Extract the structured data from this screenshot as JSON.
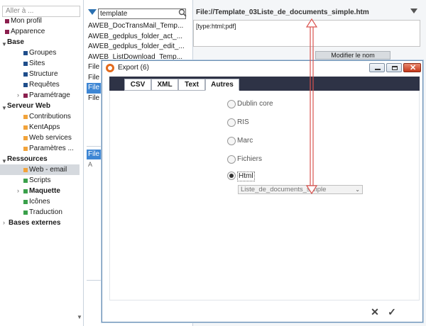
{
  "nav": {
    "search_placeholder": "Aller à ...",
    "items": [
      {
        "label": "Mon profil",
        "color": "#8b1f4e"
      },
      {
        "label": "Apparence",
        "color": "#8b1f4e"
      },
      {
        "label": "Base"
      },
      {
        "label": "Groupes",
        "color": "#1f4e8b"
      },
      {
        "label": "Sites",
        "color": "#1f4e8b"
      },
      {
        "label": "Structure",
        "color": "#1f4e8b"
      },
      {
        "label": "Requêtes",
        "color": "#1f4e8b"
      },
      {
        "label": "Paramétrage",
        "color": "#8b1f4e"
      },
      {
        "label": "Serveur Web"
      },
      {
        "label": "Contributions",
        "color": "#f2a33a"
      },
      {
        "label": "KentApps",
        "color": "#f2a33a"
      },
      {
        "label": "Web services",
        "color": "#f2a33a"
      },
      {
        "label": "Paramètres ...",
        "color": "#f2a33a"
      },
      {
        "label": "Ressources"
      },
      {
        "label": "Web - email",
        "color": "#f2a33a"
      },
      {
        "label": "Scripts",
        "color": "#3aa04a"
      },
      {
        "label": "Maquette",
        "color": "#3aa04a"
      },
      {
        "label": "Icônes",
        "color": "#3aa04a"
      },
      {
        "label": "Traduction",
        "color": "#3aa04a"
      },
      {
        "label": "Bases externes"
      }
    ]
  },
  "list": {
    "search_value": "template",
    "items": [
      "AWEB_DocTransMail_Temp...",
      "AWEB_gedplus_folder_act_...",
      "AWEB_gedplus_folder_edit_...",
      "AWEB_ListDownload_Temp...",
      "File",
      "File",
      "File",
      "File"
    ],
    "lower_selected": "File",
    "lower_marker": "A"
  },
  "detail": {
    "title": "File://Template_03Liste_de_documents_simple.htm",
    "types": "[type:html;pdf]",
    "modify_label": "Modifier le nom"
  },
  "dialog": {
    "title": "Export (6)",
    "tabs": [
      "CSV",
      "XML",
      "Text",
      "Autres"
    ],
    "active_tab": "Autres",
    "options": [
      "Dublin core",
      "RIS",
      "Marc",
      "Fichiers",
      "Html"
    ],
    "selected_option": "Html",
    "select_value": "Liste_de_documents_simple"
  },
  "colors": {
    "selection": "#3d86d4",
    "tabbar": "#2e3346",
    "arrow": "#d9534f"
  }
}
